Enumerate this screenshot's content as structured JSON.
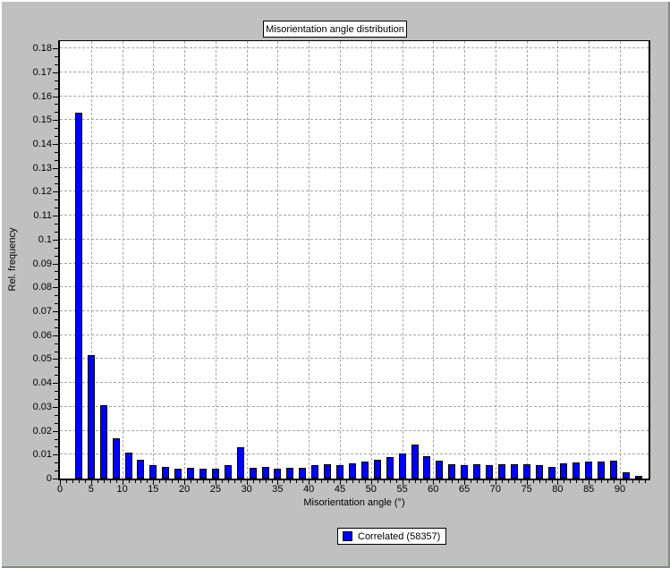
{
  "window": {
    "background": "#c0c0c0"
  },
  "title_box": {
    "label": "Misorientation angle distribution"
  },
  "legend": {
    "items": [
      {
        "label": "Correlated (58357)",
        "color": "#0000ff"
      }
    ]
  },
  "chart_data": {
    "type": "bar",
    "title": "Misorientation angle distribution",
    "xlabel": "Misorientation angle (°)",
    "ylabel": "Rel. frequency",
    "xlim": [
      0,
      94.6
    ],
    "ylim": [
      0,
      0.183
    ],
    "grid": true,
    "legend_position": "bottom-center",
    "bar_color": "#0000ff",
    "bar_border_color": "#000000",
    "gridline_color": "#a6a6a6",
    "series_name": "Correlated (58357)",
    "x_ticks": [
      0,
      5,
      10,
      15,
      20,
      25,
      30,
      35,
      40,
      45,
      50,
      55,
      60,
      65,
      70,
      75,
      80,
      85,
      90
    ],
    "y_ticks": [
      "0",
      "0.01",
      "0.02",
      "0.03",
      "0.04",
      "0.05",
      "0.06",
      "0.07",
      "0.08",
      "0.09",
      "0.1",
      "0.11",
      "0.12",
      "0.13",
      "0.14",
      "0.15",
      "0.16",
      "0.17",
      "0.18"
    ],
    "x": [
      3,
      5,
      7,
      9,
      11,
      13,
      15,
      17,
      19,
      21,
      23,
      25,
      27,
      29,
      31,
      33,
      35,
      37,
      39,
      41,
      43,
      45,
      47,
      49,
      51,
      53,
      55,
      57,
      59,
      61,
      63,
      65,
      67,
      69,
      71,
      73,
      75,
      77,
      79,
      81,
      83,
      85,
      87,
      89,
      91,
      93
    ],
    "values": [
      0.153,
      0.0515,
      0.0305,
      0.017,
      0.011,
      0.008,
      0.0055,
      0.0048,
      0.004,
      0.0045,
      0.004,
      0.004,
      0.0055,
      0.013,
      0.0045,
      0.005,
      0.004,
      0.0045,
      0.0045,
      0.0055,
      0.006,
      0.0057,
      0.0063,
      0.007,
      0.008,
      0.009,
      0.0105,
      0.0143,
      0.0093,
      0.0075,
      0.006,
      0.0055,
      0.006,
      0.0055,
      0.006,
      0.006,
      0.0061,
      0.0055,
      0.005,
      0.0062,
      0.0066,
      0.007,
      0.007,
      0.0075,
      0.0028,
      0.001
    ]
  }
}
